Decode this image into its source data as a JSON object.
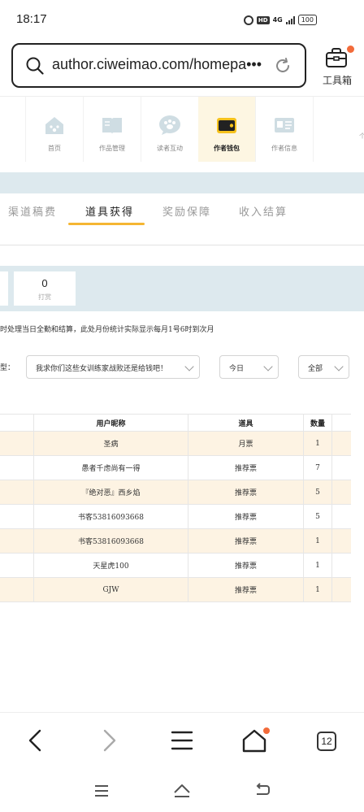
{
  "status_bar": {
    "time": "18:17",
    "hd": "HD",
    "network": "4G",
    "battery": "100"
  },
  "url_bar": {
    "url": "author.ciweimao.com/homepa•••"
  },
  "toolbox": {
    "label": "工具箱"
  },
  "nav": {
    "items": [
      {
        "label": "首页",
        "icon": "home-icon",
        "active": false
      },
      {
        "label": "作品管理",
        "icon": "book-icon",
        "active": false
      },
      {
        "label": "读者互动",
        "icon": "paw-chat-icon",
        "active": false
      },
      {
        "label": "作者钱包",
        "icon": "wallet-icon",
        "active": true
      },
      {
        "label": "作者信息",
        "icon": "id-card-icon",
        "active": false
      }
    ],
    "edge_text": "个"
  },
  "tabs": [
    {
      "label": "渠道稿费",
      "active": false
    },
    {
      "label": "道具获得",
      "active": true
    },
    {
      "label": "奖励保障",
      "active": false
    },
    {
      "label": "收入结算",
      "active": false
    }
  ],
  "stats": {
    "tip_value": "0",
    "tip_label": "打赏"
  },
  "notice": "时处理当日全勤和结算，此处月份统计实际显示每月1号6时到次月",
  "filters": {
    "label": "型：",
    "book": "我求你们这些女训练家战败还是给钱吧！",
    "date": "今日",
    "type": "全部"
  },
  "table": {
    "headers": {
      "nickname": "用户昵称",
      "item": "道具",
      "count": "数量"
    },
    "rows": [
      {
        "nickname": "圣病",
        "item": "月票",
        "count": "1"
      },
      {
        "nickname": "愚者千虑尚有一得",
        "item": "推荐票",
        "count": "7"
      },
      {
        "nickname": "『绝对恶』西乡焰",
        "item": "推荐票",
        "count": "5"
      },
      {
        "nickname": "书客53816093668",
        "item": "推荐票",
        "count": "5"
      },
      {
        "nickname": "书客53816093668",
        "item": "推荐票",
        "count": "1"
      },
      {
        "nickname": "天星虎100",
        "item": "推荐票",
        "count": "1"
      },
      {
        "nickname": "GJW",
        "item": "推荐票",
        "count": "1"
      }
    ]
  },
  "browser_nav": {
    "tab_count": "12"
  },
  "colors": {
    "accent": "#f5b632",
    "band": "#dde9ee",
    "row_alt": "#fdf3e3",
    "notify_dot": "#f26b3a"
  }
}
